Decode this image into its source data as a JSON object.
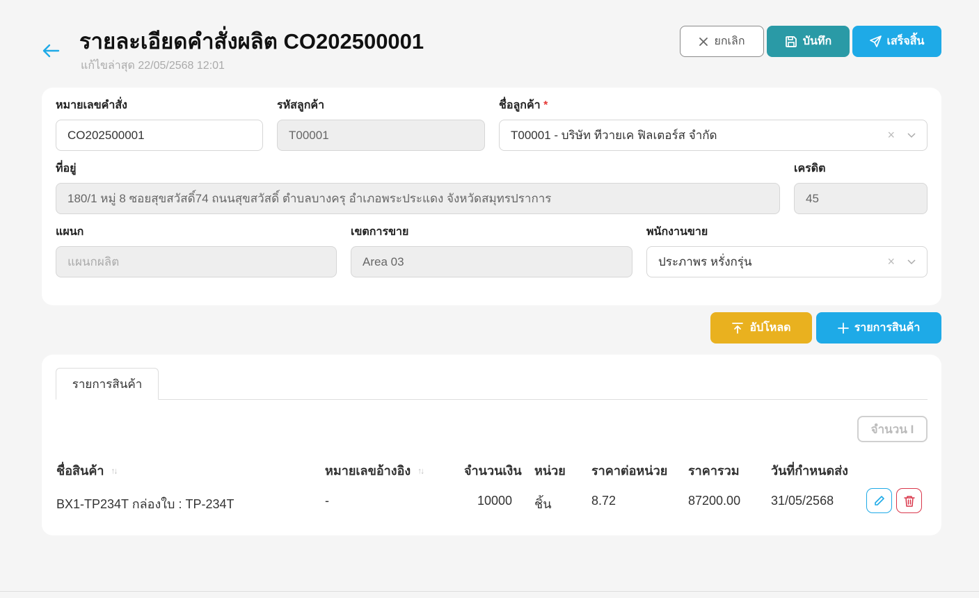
{
  "header": {
    "title": "รายละเอียดคำสั่งผลิต CO202500001",
    "last_edited": "แก้ไขล่าสุด 22/05/2568 12:01",
    "cancel_label": "ยกเลิก",
    "save_label": "บันทึก",
    "submit_label": "เสร็จสิ้น"
  },
  "form": {
    "order_no": {
      "label": "หมายเลขคำสั่ง",
      "value": "CO202500001"
    },
    "customer_code": {
      "label": "รหัสลูกค้า",
      "value": "T00001"
    },
    "customer_name": {
      "label": "ชื่อลูกค้า",
      "required": "*",
      "value": "T00001 - บริษัท ทีวายเค ฟิลเตอร์ส จำกัด"
    },
    "address": {
      "label": "ที่อยู่",
      "value": "180/1 หมู่ 8 ซอยสุขสวัสดิ์74 ถนนสุขสวัสดิ์ ตำบลบางครุ อำเภอพระประแดง จังหวัดสมุทรปราการ"
    },
    "credit": {
      "label": "เครดิต",
      "value": "45"
    },
    "department": {
      "label": "แผนก",
      "value": "แผนกผลิต"
    },
    "sales_area": {
      "label": "เขตการขาย",
      "value": "Area 03"
    },
    "salesperson": {
      "label": "พนักงานขาย",
      "value": "ประภาพร หรั่งกรุ่น"
    }
  },
  "actions": {
    "upload_label": "อัปโหลด",
    "add_item_label": "รายการสินค้า"
  },
  "items": {
    "tab_label": "รายการสินค้า",
    "column_button_label": "จำนวน I",
    "columns": {
      "product": "ชื่อสินค้า",
      "reference": "หมายเลขอ้างอิง",
      "amount": "จำนวนเงิน",
      "unit": "หน่วย",
      "unit_price": "ราคาต่อหน่วย",
      "total": "ราคารวม",
      "due_date": "วันที่กำหนดส่ง"
    },
    "rows": [
      {
        "product": "BX1-TP234T กล่องใบ : TP-234T",
        "reference": "-",
        "amount": "10000",
        "unit": "ชิ้น",
        "unit_price": "8.72",
        "total": "87200.00",
        "due_date": "31/05/2568"
      }
    ]
  },
  "icons": {
    "back": "arrow-left-icon",
    "cancel": "close-icon",
    "save": "floppy-disk-icon",
    "submit": "send-icon",
    "upload": "upload-icon",
    "add": "plus-icon",
    "edit": "pencil-icon",
    "delete": "trash-icon"
  },
  "colors": {
    "save": "#2a9aa6",
    "primary": "#1eaae7",
    "upload": "#e9b11f",
    "danger": "#d9364a",
    "background": "#f5f5f5"
  }
}
